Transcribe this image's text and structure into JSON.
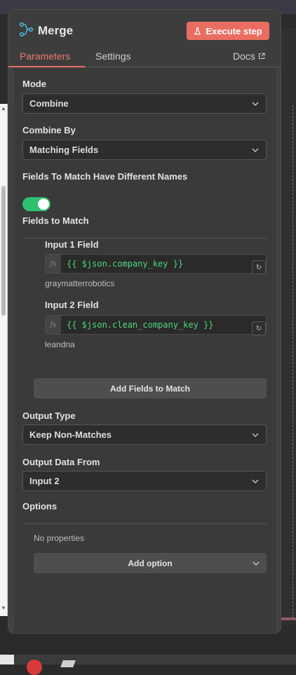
{
  "node": {
    "title": "Merge",
    "execute_label": "Execute step",
    "tabs": [
      {
        "label": "Parameters",
        "active": true
      },
      {
        "label": "Settings",
        "active": false
      }
    ],
    "docs_label": "Docs"
  },
  "params": {
    "mode": {
      "label": "Mode",
      "value": "Combine"
    },
    "combine_by": {
      "label": "Combine By",
      "value": "Matching Fields"
    },
    "different_names": {
      "label": "Fields To Match Have Different Names",
      "enabled": true
    },
    "fields_to_match": {
      "label": "Fields to Match",
      "input1": {
        "label": "Input 1 Field",
        "expression": "{{ $json.company_key }}",
        "preview": "graymatterrobotics"
      },
      "input2": {
        "label": "Input 2 Field",
        "expression": "{{ $json.clean_company_key }}",
        "preview": "leandna"
      },
      "fx_label": "fx",
      "add_button": "Add Fields to Match"
    },
    "output_type": {
      "label": "Output Type",
      "value": "Keep Non-Matches"
    },
    "output_data_from": {
      "label": "Output Data From",
      "value": "Input 2"
    },
    "options": {
      "label": "Options",
      "empty_text": "No properties",
      "add_button": "Add option"
    }
  },
  "colors": {
    "accent": "#ea6d61",
    "toggle": "#2fbf71",
    "expression": "#4cd97c"
  }
}
